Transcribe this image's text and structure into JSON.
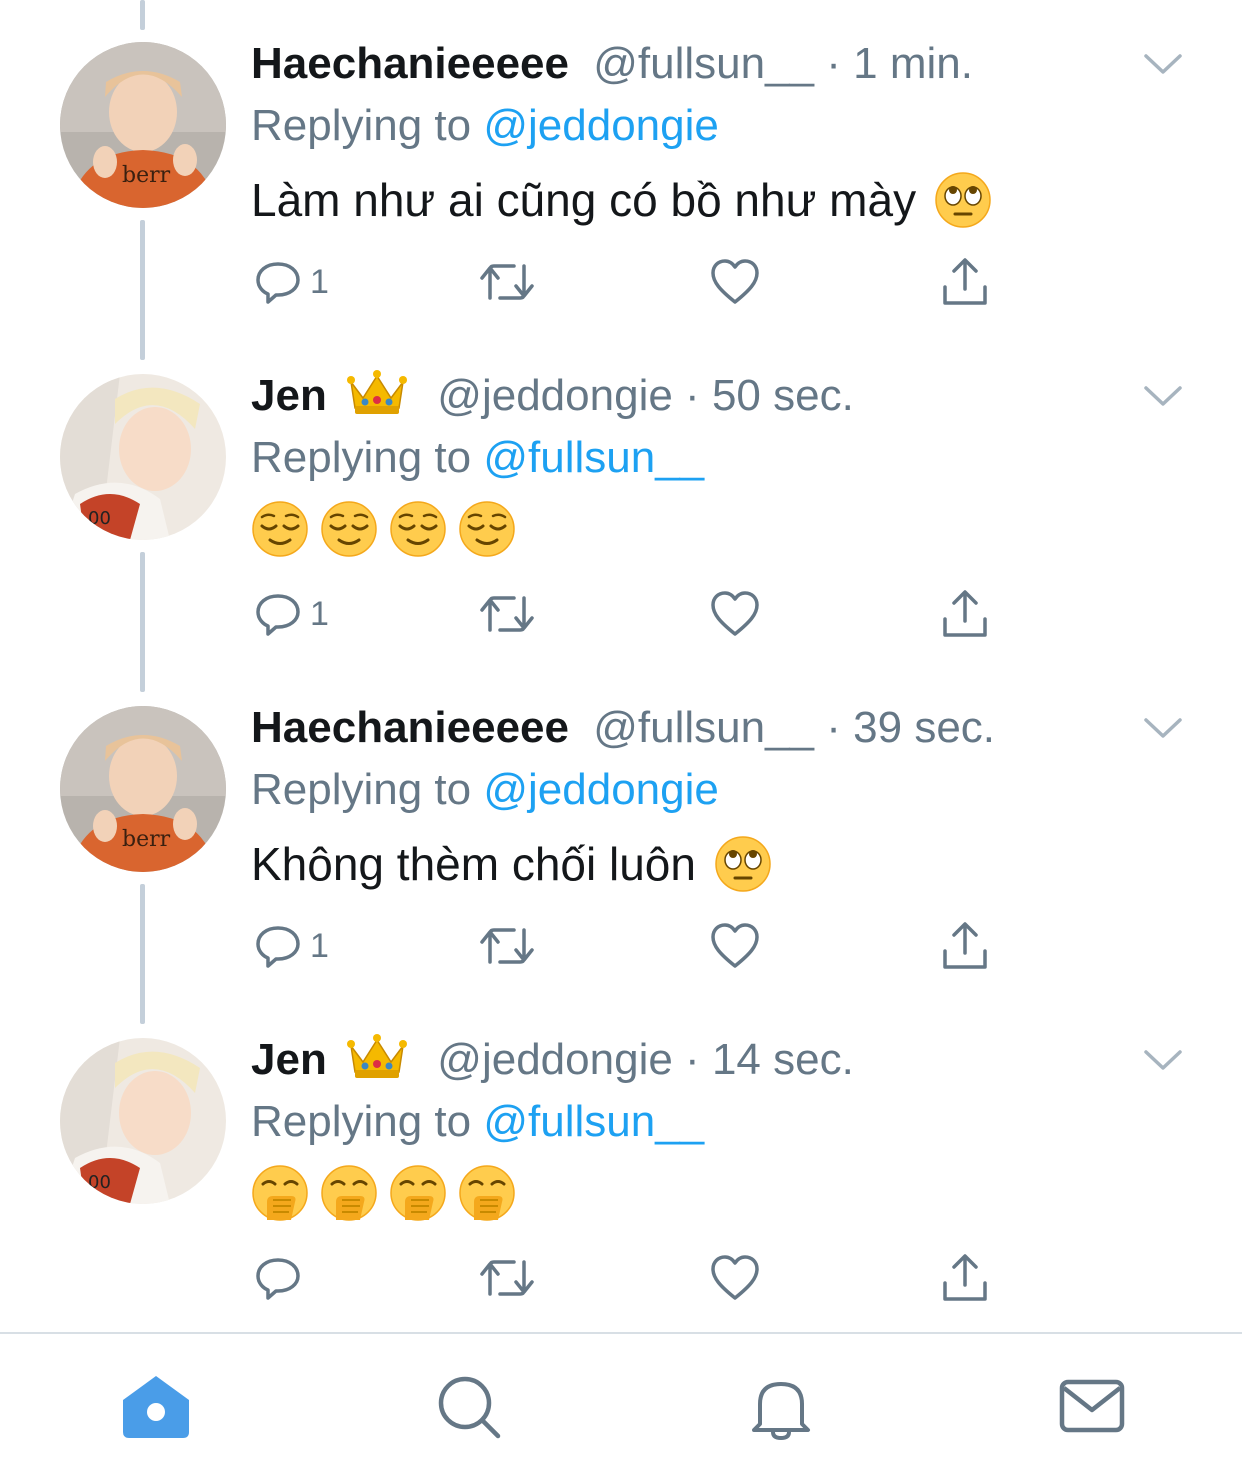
{
  "tweets": [
    {
      "display_name": "Haechanieeeee",
      "handle": "@fullsun__",
      "dot": "·",
      "time": "1 min.",
      "replying_prefix": "Replying to ",
      "replying_to": "@jeddongie",
      "text": "Làm như ai cũng có bồ như mày",
      "emojis": [
        "face-with-rolling-eyes"
      ],
      "reply_count": "1",
      "has_crown": false
    },
    {
      "display_name": "Jen",
      "handle": "@jeddongie",
      "dot": "·",
      "time": "50 sec.",
      "replying_prefix": "Replying to ",
      "replying_to": "@fullsun__",
      "text": "",
      "emojis": [
        "relieved-face",
        "relieved-face",
        "relieved-face",
        "relieved-face"
      ],
      "reply_count": "1",
      "has_crown": true
    },
    {
      "display_name": "Haechanieeeee",
      "handle": "@fullsun__",
      "dot": "·",
      "time": "39 sec.",
      "replying_prefix": "Replying to ",
      "replying_to": "@jeddongie",
      "text": "Không thèm chối luôn",
      "emojis": [
        "face-with-rolling-eyes"
      ],
      "reply_count": "1",
      "has_crown": false
    },
    {
      "display_name": "Jen",
      "handle": "@jeddongie",
      "dot": "·",
      "time": "14 sec.",
      "replying_prefix": "Replying to ",
      "replying_to": "@fullsun__",
      "text": "",
      "emojis": [
        "face-with-hand-over-mouth",
        "face-with-hand-over-mouth",
        "face-with-hand-over-mouth",
        "face-with-hand-over-mouth"
      ],
      "reply_count": "",
      "has_crown": true
    }
  ],
  "tabbar": {
    "items": [
      "home-icon",
      "search-icon",
      "notifications-icon",
      "messages-icon"
    ],
    "active": "home-icon"
  },
  "colors": {
    "accent": "#1da1f2",
    "tab_active": "#4a9de8",
    "secondary_text": "#657786",
    "thread_line": "#c4cfda",
    "icon_gray": "#657786"
  }
}
